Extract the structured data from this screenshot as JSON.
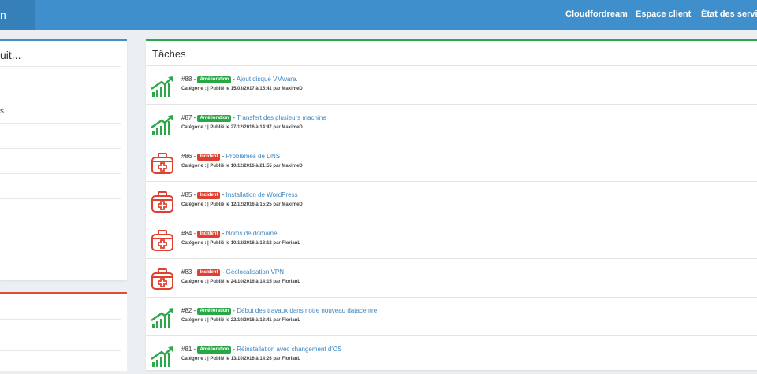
{
  "navbar": {
    "brand": "n",
    "links": [
      "Cloudfordream",
      "Espace client",
      "État des services"
    ]
  },
  "left_panel": {
    "title": "uit...",
    "items": [
      "",
      "s",
      "",
      "",
      "",
      "",
      "",
      ""
    ]
  },
  "main_panel": {
    "title": "Tâches",
    "tasks": [
      {
        "num": "#88 -",
        "badge": "Amélioration",
        "type": "amelioration",
        "title": "Ajout disque VMware.",
        "meta": "Catégorie : | Publié le 15/03/2017 à 15:41 par MaximeD",
        "icon": "growth-chart-icon"
      },
      {
        "num": "#87 -",
        "badge": "Amélioration",
        "type": "amelioration",
        "title": "Transfert des plusieurs machine",
        "meta": "Catégorie : | Publié le 27/12/2016 à 14:47 par MaximeD",
        "icon": "growth-chart-icon"
      },
      {
        "num": "#86 -",
        "badge": "Incident",
        "type": "incident",
        "title": "Problèmes de DNS",
        "meta": "Catégorie : | Publié le 10/12/2016 à 21:55 par MaximeD",
        "icon": "first-aid-kit-icon"
      },
      {
        "num": "#85 -",
        "badge": "Incident",
        "type": "incident",
        "title": "Installation de WordPress",
        "meta": "Catégorie : | Publié le 12/12/2016 à 15:25 par MaximeD",
        "icon": "first-aid-kit-icon"
      },
      {
        "num": "#84 -",
        "badge": "Incident",
        "type": "incident",
        "title": "Noms de domaine",
        "meta": "Catégorie : | Publié le 10/12/2016 à 18:18 par FlorianL",
        "icon": "first-aid-kit-icon"
      },
      {
        "num": "#83 -",
        "badge": "Incident",
        "type": "incident",
        "title": "Géolocalisation VPN",
        "meta": "Catégorie : | Publié le 24/10/2016 à 14:15 par FlorianL",
        "icon": "first-aid-kit-icon"
      },
      {
        "num": "#82 -",
        "badge": "Amélioration",
        "type": "amelioration",
        "title": "Début des travaux dans notre nouveau datacentre",
        "meta": "Catégorie : | Publié le 22/10/2016 à 13:41 par FlorianL",
        "icon": "growth-chart-icon"
      },
      {
        "num": "#81 -",
        "badge": "Amélioration",
        "type": "amelioration",
        "title": "Réinstallation avec changement d'OS",
        "meta": "Catégorie : | Publié le 13/10/2016 à 14:26 par FlorianL",
        "icon": "growth-chart-icon"
      }
    ]
  },
  "colors": {
    "navbar": "#3e8fcb",
    "amelioration": "#28a745",
    "incident": "#e0402f",
    "link": "#3a84c0"
  }
}
